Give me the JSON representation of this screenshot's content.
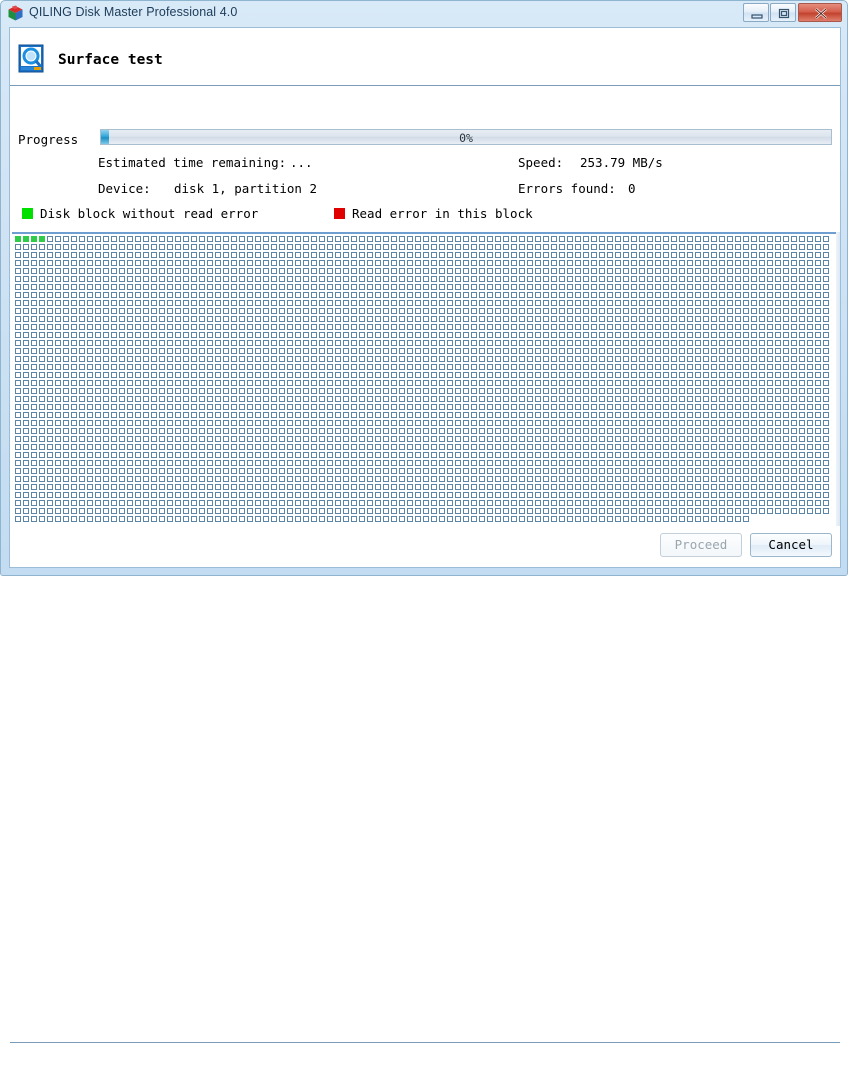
{
  "window": {
    "title": "QILING Disk Master Professional 4.0",
    "icon": "cube-icon",
    "controls": {
      "minimize": "minimize-icon",
      "maximize": "maximize-icon",
      "close": "close-icon"
    }
  },
  "header": {
    "icon": "disk-surface-scan-icon",
    "title": "Surface test"
  },
  "progress": {
    "label": "Progress",
    "percent_text": "0%",
    "percent_value": 0
  },
  "info": {
    "eta_label": "Estimated time remaining:",
    "eta_value": "...",
    "device_label": "Device:",
    "device_value": "disk 1, partition 2",
    "speed_label": "Speed:",
    "speed_value": "253.79 MB/s",
    "errors_label": "Errors found:",
    "errors_value": "0"
  },
  "legend": {
    "ok_text": "Disk block without read error",
    "ok_color": "#00e000",
    "err_text": "Read error in this block",
    "err_color": "#e00000"
  },
  "grid": {
    "columns": 102,
    "rows": 36,
    "last_row_cells": 92,
    "scanned_blocks": 4,
    "error_blocks": 0,
    "ok_color": "#2ecc49",
    "err_color": "#e01010",
    "empty_border_color": "#5b86a8"
  },
  "footer": {
    "proceed_label": "Proceed",
    "proceed_enabled": false,
    "cancel_label": "Cancel",
    "cancel_enabled": true
  }
}
